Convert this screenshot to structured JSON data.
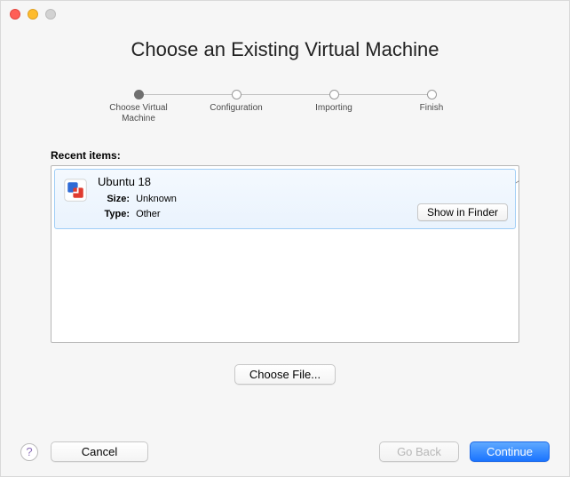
{
  "title": "Choose an Existing Virtual Machine",
  "steps": [
    {
      "label": "Choose Virtual Machine",
      "active": true
    },
    {
      "label": "Configuration",
      "active": false
    },
    {
      "label": "Importing",
      "active": false
    },
    {
      "label": "Finish",
      "active": false
    }
  ],
  "recent": {
    "header": "Recent items:",
    "items": [
      {
        "name": "Ubuntu 18",
        "size_label": "Size:",
        "size_value": "Unknown",
        "type_label": "Type:",
        "type_value": "Other",
        "show_in_finder": "Show in Finder"
      }
    ]
  },
  "buttons": {
    "choose_file": "Choose File...",
    "cancel": "Cancel",
    "go_back": "Go Back",
    "continue": "Continue",
    "help": "?"
  }
}
